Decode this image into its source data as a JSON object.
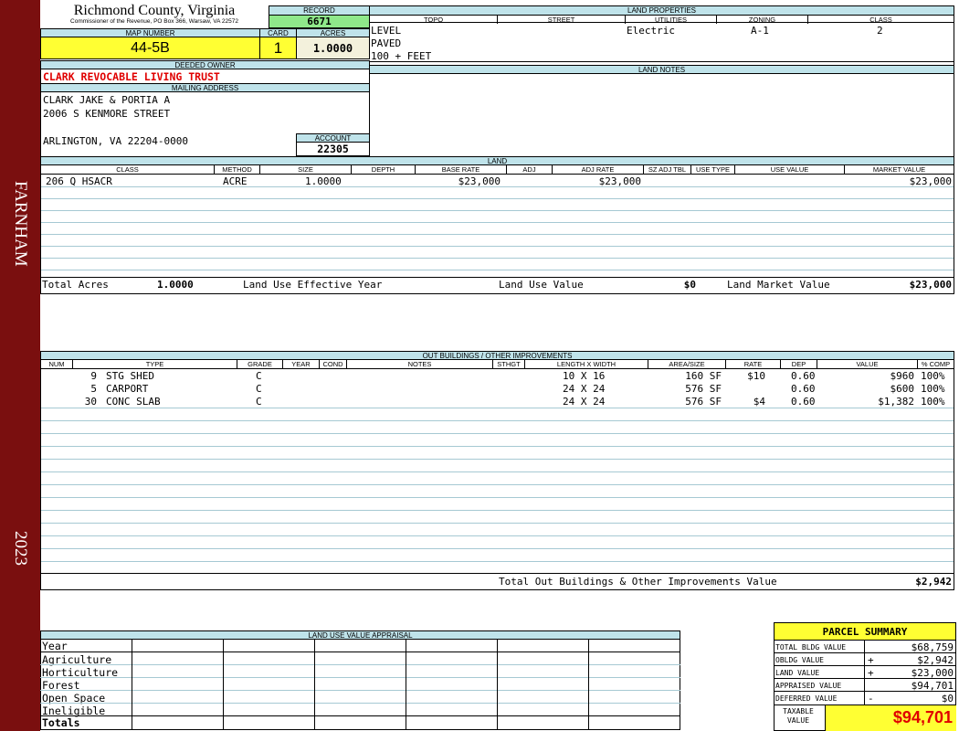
{
  "sidebar": {
    "name": "FARNHAM",
    "year": "2023"
  },
  "header": {
    "county": "Richmond County, Virginia",
    "address": "Commissioner of the Revenue, PO Box 366, Warsaw, VA 22572",
    "record_label": "RECORD",
    "record": "6671",
    "map_label": "MAP NUMBER",
    "map": "44-5B",
    "card_label": "CARD",
    "card": "1",
    "acres_label": "ACRES",
    "acres": "1.0000"
  },
  "owner": {
    "deeded_label": "DEEDED OWNER",
    "deeded": "CLARK REVOCABLE LIVING TRUST",
    "mailing_label": "MAILING ADDRESS",
    "line1": "CLARK JAKE & PORTIA A",
    "line2": "2006 S KENMORE STREET",
    "line3": "ARLINGTON, VA 22204-0000",
    "account_label": "ACCOUNT",
    "account": "22305"
  },
  "land_properties": {
    "title": "LAND PROPERTIES",
    "columns": [
      "TOPO",
      "STREET",
      "UTILITIES",
      "ZONING",
      "CLASS"
    ],
    "topo": [
      "LEVEL",
      "PAVED",
      "100 + FEET"
    ],
    "utilities": "Electric",
    "zoning": "A-1",
    "class": "2"
  },
  "land_notes": {
    "title": "LAND NOTES"
  },
  "land": {
    "title": "LAND",
    "columns": [
      "CLASS",
      "METHOD",
      "SIZE",
      "DEPTH",
      "BASE RATE",
      "ADJ",
      "ADJ RATE",
      "SZ ADJ TBL",
      "USE TYPE",
      "USE VALUE",
      "MARKET VALUE"
    ],
    "rows": [
      {
        "class": "206 Q HSACR",
        "method": "ACRE",
        "size": "1.0000",
        "base_rate": "$23,000",
        "adj_rate": "$23,000",
        "market_value": "$23,000"
      }
    ],
    "total_acres_label": "Total Acres",
    "total_acres": "1.0000",
    "effective_year_label": "Land Use Effective Year",
    "use_value_label": "Land Use Value",
    "use_value": "$0",
    "market_label": "Land Market Value",
    "market_value": "$23,000"
  },
  "outbuildings": {
    "title": "OUT BUILDINGS / OTHER IMPROVEMENTS",
    "columns": [
      "NUM",
      "TYPE",
      "GRADE",
      "YEAR",
      "COND",
      "NOTES",
      "STHGT",
      "LENGTH X WIDTH",
      "AREA/SIZE",
      "RATE",
      "DEP",
      "VALUE",
      "% COMP"
    ],
    "rows": [
      {
        "num": "9",
        "type": "STG SHED",
        "grade": "C",
        "lw": "10 X 16",
        "area": "160 SF",
        "rate": "$10",
        "dep": "0.60",
        "value": "$960",
        "comp": "100%"
      },
      {
        "num": "5",
        "type": "CARPORT",
        "grade": "C",
        "lw": "24 X 24",
        "area": "576 SF",
        "rate": "",
        "dep": "0.60",
        "value": "$600",
        "comp": "100%"
      },
      {
        "num": "30",
        "type": "CONC SLAB",
        "grade": "C",
        "lw": "24 X 24",
        "area": "576 SF",
        "rate": "$4",
        "dep": "0.60",
        "value": "$1,382",
        "comp": "100%"
      }
    ],
    "total_label": "Total Out Buildings & Other Improvements Value",
    "total": "$2,942"
  },
  "luv": {
    "title": "LAND USE VALUE APPRAISAL",
    "rows": [
      "Year",
      "Agriculture",
      "Horticulture",
      "Forest",
      "Open Space",
      "Ineligible",
      "Totals"
    ]
  },
  "summary": {
    "title": "PARCEL SUMMARY",
    "rows": [
      {
        "label": "TOTAL BLDG VALUE",
        "sign": "",
        "value": "$68,759"
      },
      {
        "label": "OBLDG VALUE",
        "sign": "+",
        "value": "$2,942"
      },
      {
        "label": "LAND VALUE",
        "sign": "+",
        "value": "$23,000"
      },
      {
        "label": "APPRAISED VALUE",
        "sign": "",
        "value": "$94,701"
      },
      {
        "label": "DEFERRED VALUE",
        "sign": "-",
        "value": "$0"
      }
    ],
    "taxable_label": "TAXABLE VALUE",
    "taxable": "$94,701"
  }
}
